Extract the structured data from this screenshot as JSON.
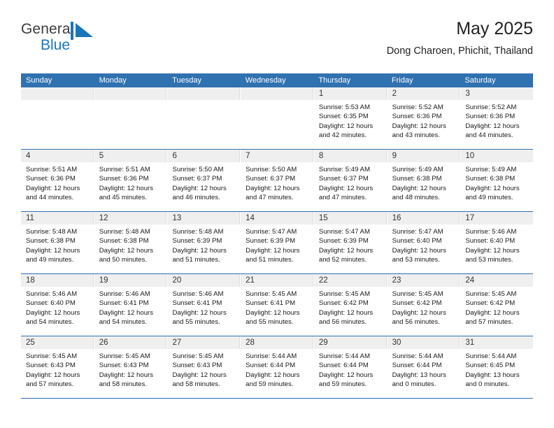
{
  "brand": {
    "name_part1": "General",
    "name_part2": "Blue",
    "mark": "triangle-logo-icon"
  },
  "header": {
    "title": "May 2025",
    "subtitle": "Dong Charoen, Phichit, Thailand"
  },
  "colors": {
    "header_blue": "#3071b0",
    "brand_blue": "#1b75bb",
    "day_strip_gray": "#efefef",
    "text": "#1a1a1a"
  },
  "calendar": {
    "weekday_headers": [
      "Sunday",
      "Monday",
      "Tuesday",
      "Wednesday",
      "Thursday",
      "Friday",
      "Saturday"
    ],
    "weeks": [
      [
        {
          "day": "",
          "lines": []
        },
        {
          "day": "",
          "lines": []
        },
        {
          "day": "",
          "lines": []
        },
        {
          "day": "",
          "lines": []
        },
        {
          "day": "1",
          "lines": [
            "Sunrise: 5:53 AM",
            "Sunset: 6:35 PM",
            "Daylight: 12 hours",
            "and 42 minutes."
          ]
        },
        {
          "day": "2",
          "lines": [
            "Sunrise: 5:52 AM",
            "Sunset: 6:36 PM",
            "Daylight: 12 hours",
            "and 43 minutes."
          ]
        },
        {
          "day": "3",
          "lines": [
            "Sunrise: 5:52 AM",
            "Sunset: 6:36 PM",
            "Daylight: 12 hours",
            "and 44 minutes."
          ]
        }
      ],
      [
        {
          "day": "4",
          "lines": [
            "Sunrise: 5:51 AM",
            "Sunset: 6:36 PM",
            "Daylight: 12 hours",
            "and 44 minutes."
          ]
        },
        {
          "day": "5",
          "lines": [
            "Sunrise: 5:51 AM",
            "Sunset: 6:36 PM",
            "Daylight: 12 hours",
            "and 45 minutes."
          ]
        },
        {
          "day": "6",
          "lines": [
            "Sunrise: 5:50 AM",
            "Sunset: 6:37 PM",
            "Daylight: 12 hours",
            "and 46 minutes."
          ]
        },
        {
          "day": "7",
          "lines": [
            "Sunrise: 5:50 AM",
            "Sunset: 6:37 PM",
            "Daylight: 12 hours",
            "and 47 minutes."
          ]
        },
        {
          "day": "8",
          "lines": [
            "Sunrise: 5:49 AM",
            "Sunset: 6:37 PM",
            "Daylight: 12 hours",
            "and 47 minutes."
          ]
        },
        {
          "day": "9",
          "lines": [
            "Sunrise: 5:49 AM",
            "Sunset: 6:38 PM",
            "Daylight: 12 hours",
            "and 48 minutes."
          ]
        },
        {
          "day": "10",
          "lines": [
            "Sunrise: 5:49 AM",
            "Sunset: 6:38 PM",
            "Daylight: 12 hours",
            "and 49 minutes."
          ]
        }
      ],
      [
        {
          "day": "11",
          "lines": [
            "Sunrise: 5:48 AM",
            "Sunset: 6:38 PM",
            "Daylight: 12 hours",
            "and 49 minutes."
          ]
        },
        {
          "day": "12",
          "lines": [
            "Sunrise: 5:48 AM",
            "Sunset: 6:38 PM",
            "Daylight: 12 hours",
            "and 50 minutes."
          ]
        },
        {
          "day": "13",
          "lines": [
            "Sunrise: 5:48 AM",
            "Sunset: 6:39 PM",
            "Daylight: 12 hours",
            "and 51 minutes."
          ]
        },
        {
          "day": "14",
          "lines": [
            "Sunrise: 5:47 AM",
            "Sunset: 6:39 PM",
            "Daylight: 12 hours",
            "and 51 minutes."
          ]
        },
        {
          "day": "15",
          "lines": [
            "Sunrise: 5:47 AM",
            "Sunset: 6:39 PM",
            "Daylight: 12 hours",
            "and 52 minutes."
          ]
        },
        {
          "day": "16",
          "lines": [
            "Sunrise: 5:47 AM",
            "Sunset: 6:40 PM",
            "Daylight: 12 hours",
            "and 53 minutes."
          ]
        },
        {
          "day": "17",
          "lines": [
            "Sunrise: 5:46 AM",
            "Sunset: 6:40 PM",
            "Daylight: 12 hours",
            "and 53 minutes."
          ]
        }
      ],
      [
        {
          "day": "18",
          "lines": [
            "Sunrise: 5:46 AM",
            "Sunset: 6:40 PM",
            "Daylight: 12 hours",
            "and 54 minutes."
          ]
        },
        {
          "day": "19",
          "lines": [
            "Sunrise: 5:46 AM",
            "Sunset: 6:41 PM",
            "Daylight: 12 hours",
            "and 54 minutes."
          ]
        },
        {
          "day": "20",
          "lines": [
            "Sunrise: 5:46 AM",
            "Sunset: 6:41 PM",
            "Daylight: 12 hours",
            "and 55 minutes."
          ]
        },
        {
          "day": "21",
          "lines": [
            "Sunrise: 5:45 AM",
            "Sunset: 6:41 PM",
            "Daylight: 12 hours",
            "and 55 minutes."
          ]
        },
        {
          "day": "22",
          "lines": [
            "Sunrise: 5:45 AM",
            "Sunset: 6:42 PM",
            "Daylight: 12 hours",
            "and 56 minutes."
          ]
        },
        {
          "day": "23",
          "lines": [
            "Sunrise: 5:45 AM",
            "Sunset: 6:42 PM",
            "Daylight: 12 hours",
            "and 56 minutes."
          ]
        },
        {
          "day": "24",
          "lines": [
            "Sunrise: 5:45 AM",
            "Sunset: 6:42 PM",
            "Daylight: 12 hours",
            "and 57 minutes."
          ]
        }
      ],
      [
        {
          "day": "25",
          "lines": [
            "Sunrise: 5:45 AM",
            "Sunset: 6:43 PM",
            "Daylight: 12 hours",
            "and 57 minutes."
          ]
        },
        {
          "day": "26",
          "lines": [
            "Sunrise: 5:45 AM",
            "Sunset: 6:43 PM",
            "Daylight: 12 hours",
            "and 58 minutes."
          ]
        },
        {
          "day": "27",
          "lines": [
            "Sunrise: 5:45 AM",
            "Sunset: 6:43 PM",
            "Daylight: 12 hours",
            "and 58 minutes."
          ]
        },
        {
          "day": "28",
          "lines": [
            "Sunrise: 5:44 AM",
            "Sunset: 6:44 PM",
            "Daylight: 12 hours",
            "and 59 minutes."
          ]
        },
        {
          "day": "29",
          "lines": [
            "Sunrise: 5:44 AM",
            "Sunset: 6:44 PM",
            "Daylight: 12 hours",
            "and 59 minutes."
          ]
        },
        {
          "day": "30",
          "lines": [
            "Sunrise: 5:44 AM",
            "Sunset: 6:44 PM",
            "Daylight: 13 hours",
            "and 0 minutes."
          ]
        },
        {
          "day": "31",
          "lines": [
            "Sunrise: 5:44 AM",
            "Sunset: 6:45 PM",
            "Daylight: 13 hours",
            "and 0 minutes."
          ]
        }
      ]
    ]
  }
}
